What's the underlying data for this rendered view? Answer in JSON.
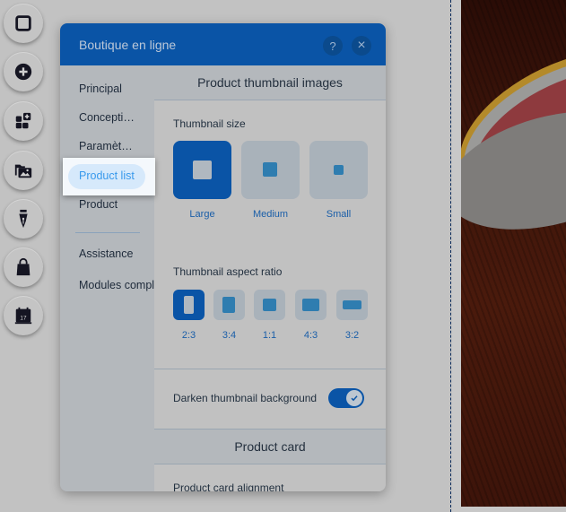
{
  "toolbar": {
    "items": [
      {
        "name": "page-frame",
        "icon": "square-frame-icon"
      },
      {
        "name": "add",
        "icon": "plus-circle-icon"
      },
      {
        "name": "apps",
        "icon": "apps-add-icon"
      },
      {
        "name": "media",
        "icon": "media-folder-icon"
      },
      {
        "name": "design",
        "icon": "pen-nib-icon"
      },
      {
        "name": "store",
        "icon": "shopping-bag-icon"
      },
      {
        "name": "bookings",
        "icon": "calendar-icon",
        "badge": "17"
      }
    ]
  },
  "panel": {
    "title": "Boutique en ligne",
    "help_label": "?",
    "close_label": "×",
    "nav": {
      "items": [
        {
          "label": "Principal"
        },
        {
          "label": "Concepti…"
        },
        {
          "label": "Paramèt…"
        },
        {
          "label": "Product list",
          "active": true
        },
        {
          "label": "Product"
        }
      ],
      "secondary": [
        {
          "label": "Assistance"
        },
        {
          "label": "Modules compl"
        }
      ]
    },
    "content": {
      "section1_title": "Product thumbnail images",
      "thumbnail_size": {
        "label": "Thumbnail size",
        "options": [
          {
            "label": "Large",
            "selected": true
          },
          {
            "label": "Medium",
            "selected": false
          },
          {
            "label": "Small",
            "selected": false
          }
        ]
      },
      "aspect_ratio": {
        "label": "Thumbnail aspect ratio",
        "options": [
          {
            "label": "2:3",
            "selected": true
          },
          {
            "label": "3:4",
            "selected": false
          },
          {
            "label": "1:1",
            "selected": false
          },
          {
            "label": "4:3",
            "selected": false
          },
          {
            "label": "3:2",
            "selected": false
          }
        ]
      },
      "darken_toggle": {
        "label": "Darken thumbnail background",
        "checked": true
      },
      "section2_title": "Product card",
      "card_alignment_label": "Product card alignment"
    }
  },
  "colors": {
    "accent": "#0a54a6",
    "link": "#1a5ea8",
    "highlight_text": "#3899ec"
  }
}
